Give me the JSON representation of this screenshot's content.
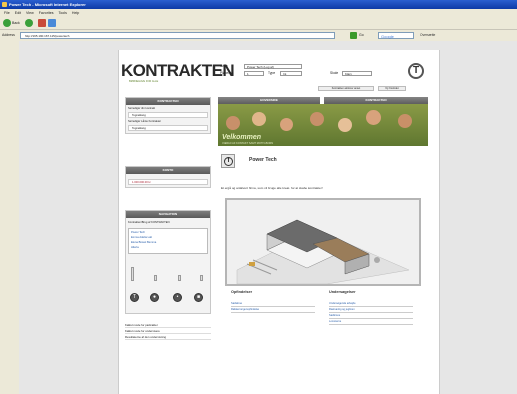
{
  "browser": {
    "title": "Power Tech - Microsoft Internet Explorer",
    "menu": [
      "File",
      "Edit",
      "View",
      "Favorites",
      "Tools",
      "Help"
    ],
    "nav": {
      "back_label": "Back"
    },
    "address": {
      "label": "Address",
      "url": "http://195.190.167.115/powertech",
      "go_label": "Go",
      "search_engine": "Google",
      "extra_label": "Oversætte"
    }
  },
  "site": {
    "logo_text": "KONTRAKTEN",
    "logo_tagline": "BØRNEHAVE FOR ALLE",
    "login": {
      "name_label": "Navn",
      "name_value": "Power Tech (Log af)",
      "placering_label": "Placering",
      "placering_value": "1",
      "type_label": "Type",
      "type_value": "Int",
      "skole_label": "Skole",
      "skole_value": "Klarv"
    },
    "top_buttons": [
      "Kontrakten advisrer anset",
      "Ny Kontrakt"
    ],
    "left_panels": {
      "panel1_head": "KONTRAKTEN",
      "panel1_row1": "Se/redigér din kontrakt",
      "panel1_item1": "Tegneklang",
      "panel1_row2": "Se/redigér Lånte Kontrakter",
      "panel1_item2": "Tegneklang",
      "panel2_head": "KONTO",
      "panel2_item": "1.000.000.00 kr",
      "panel3_head": "NAVIGATION",
      "panel3_sub": "Kontrakten/Brug af KONTRAKTEN",
      "panel3_list": [
        "Power Tech",
        "Emma Adelia Lab",
        "Elena Bravel Bemma",
        "Hilerta"
      ]
    },
    "left_links": [
      "Kalkul.mode for parkrakter",
      "Kalkul.mode for undervisere",
      "Resultaterne af den undervisning"
    ],
    "tabs": [
      "HOVEDSIDE",
      "KONTRAKTEN"
    ],
    "banner_caption": "Velkommen",
    "banner_sub": "VÆRLD AF KONTAKT SAMT MOTIV-BORN",
    "profile_title": "Power Tech",
    "profile_desc": "Et ergå og antälvert firma, som vil bruge alle kreat. for at skabe kontrakter!",
    "bottom": {
      "col1_head": "Opfindelser",
      "col1_items": [
        "Sødskrue",
        "Røkkerne/genopfindelse"
      ],
      "col2_head": "Undersøgelser",
      "col2_items": [
        "Undersøgende arbejde",
        "Rækvantig og jeglinen",
        "Sødkrone",
        "Lomsterne"
      ]
    }
  },
  "colors": {
    "ie_title": "#0d3aa6",
    "chrome": "#ece9d8",
    "panel_head": "#5a5a5a",
    "banner_green": "#6f8a38"
  }
}
